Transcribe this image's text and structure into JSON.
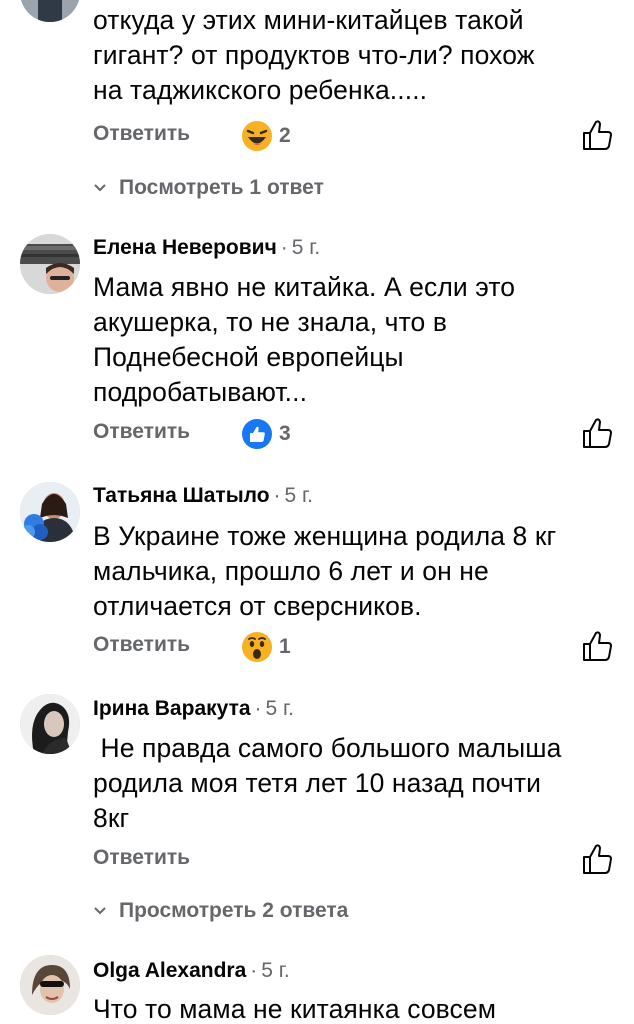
{
  "comments": [
    {
      "author": "",
      "time": "",
      "lines": [
        "откуда у этих мини-китайцев такой",
        "гигант?  от продуктов что-ли?  похож",
        "на таджикского ребенка....."
      ],
      "reply_label": "Ответить",
      "reaction": {
        "type": "haha-emoji",
        "count": "2"
      },
      "view_replies": "Посмотреть 1 ответ"
    },
    {
      "author": "Елена Неверович",
      "time": "5 г.",
      "lines": [
        "Мама явно не китайка. А если это",
        "акушерка, то не знала, что в",
        "Поднебесной европейцы",
        "подробатывают..."
      ],
      "reply_label": "Ответить",
      "reaction": {
        "type": "like-emoji",
        "count": "3"
      }
    },
    {
      "author": "Татьяна Шатыло",
      "time": "5 г.",
      "lines": [
        "В Украине тоже женщина родила 8 кг",
        "мальчика, прошло 6 лет и он не",
        "отличается от сверсников."
      ],
      "reply_label": "Ответить",
      "reaction": {
        "type": "wow-emoji",
        "count": "1"
      }
    },
    {
      "author": "Ірина Варакута",
      "time": "5 г.",
      "lines": [
        " Не правда самого большого малыша",
        "родила моя тетя лет 10 назад почти",
        "8кг"
      ],
      "reply_label": "Ответить",
      "view_replies": "Просмотреть 2 ответа"
    },
    {
      "author": "Olga Alexandra",
      "time": "5 г.",
      "lines": [
        "Что то мама не китаянка совсем"
      ]
    }
  ],
  "colors": {
    "text": "#050505",
    "secondary": "#65676b",
    "like_blue": "#1877f2",
    "emoji_yellow": "#f7b125"
  }
}
